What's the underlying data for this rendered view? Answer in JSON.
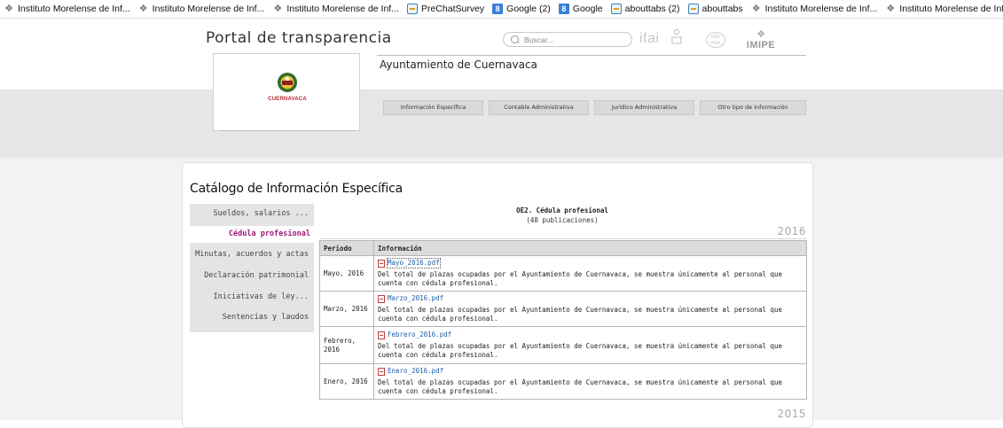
{
  "bookmarks": [
    {
      "icon": "imipe-icon",
      "label": "Instituto Morelense de Inf..."
    },
    {
      "icon": "imipe-icon",
      "label": "Instituto Morelense de Inf..."
    },
    {
      "icon": "imipe-icon",
      "label": "Instituto Morelense de Inf..."
    },
    {
      "icon": "page-icon",
      "label": "PreChatSurvey"
    },
    {
      "icon": "google-icon",
      "label": "Google (2)"
    },
    {
      "icon": "google-icon",
      "label": "Google"
    },
    {
      "icon": "page-icon",
      "label": "abouttabs (2)"
    },
    {
      "icon": "page-icon",
      "label": "abouttabs"
    },
    {
      "icon": "imipe-icon",
      "label": "Instituto Morelense de Inf..."
    },
    {
      "icon": "imipe-icon",
      "label": "Instituto Morelense de Inf..."
    }
  ],
  "header": {
    "portal_title": "Portal de transparencia",
    "search_placeholder": "Buscar...",
    "ifai_logo": "ifai",
    "info_logo": "info mex",
    "imipe_logo": "IMIPE",
    "org_name": "Ayuntamiento de Cuernavaca",
    "logo_text": "CUERNAVACA"
  },
  "nav_tabs": [
    {
      "label": "Información Específica"
    },
    {
      "label": "Contable Administrativa"
    },
    {
      "label": "Jurídico Administrativa"
    },
    {
      "label": "Otro tipo de información"
    }
  ],
  "catalog": {
    "title": "Catálogo de Información Específica",
    "sidebar": [
      {
        "label": "Sueldos, salarios ...",
        "active": false
      },
      {
        "label": "Cédula profesional",
        "active": true
      },
      {
        "label": "Minutas, acuerdos y actas",
        "active": false
      },
      {
        "label": "Declaración patrimonial",
        "active": false
      },
      {
        "label": "Iniciativas de ley...",
        "active": false
      },
      {
        "label": "Sentencias y laudos",
        "active": false
      }
    ],
    "section_title": "OE2. Cédula profesional",
    "section_count": "(48 publicaciones)",
    "years": [
      "2016",
      "2015"
    ],
    "table": {
      "headers": [
        "Periodo",
        "Información"
      ],
      "rows": [
        {
          "period": "Mayo, 2016",
          "file": "Mayo_2016.pdf",
          "description": "Del total de plazas ocupadas por el Ayuntamiento de Cuernavaca, se muestra únicamente al personal que cuenta con cédula profesional."
        },
        {
          "period": "Marzo, 2016",
          "file": "Marzo_2016.pdf",
          "description": "Del total de plazas ocupadas por el Ayuntamiento de Cuernavaca, se muestra únicamente al personal que cuenta con cédula profesional."
        },
        {
          "period": "Febrero, 2016",
          "file": "Febrero_2016.pdf",
          "description": "Del total de plazas ocupadas por el Ayuntamiento de Cuernavaca, se muestra únicamente al personal que cuenta con cédula profesional."
        },
        {
          "period": "Enero, 2016",
          "file": "Enero_2016.pdf",
          "description": "Del total de plazas ocupadas por el Ayuntamiento de Cuernavaca, se muestra únicamente al personal que cuenta con cédula profesional."
        }
      ]
    }
  },
  "colors": {
    "active_sidebar_text": "#9b1a78",
    "link": "#1d5ca8",
    "logo_red": "#b0282d"
  }
}
